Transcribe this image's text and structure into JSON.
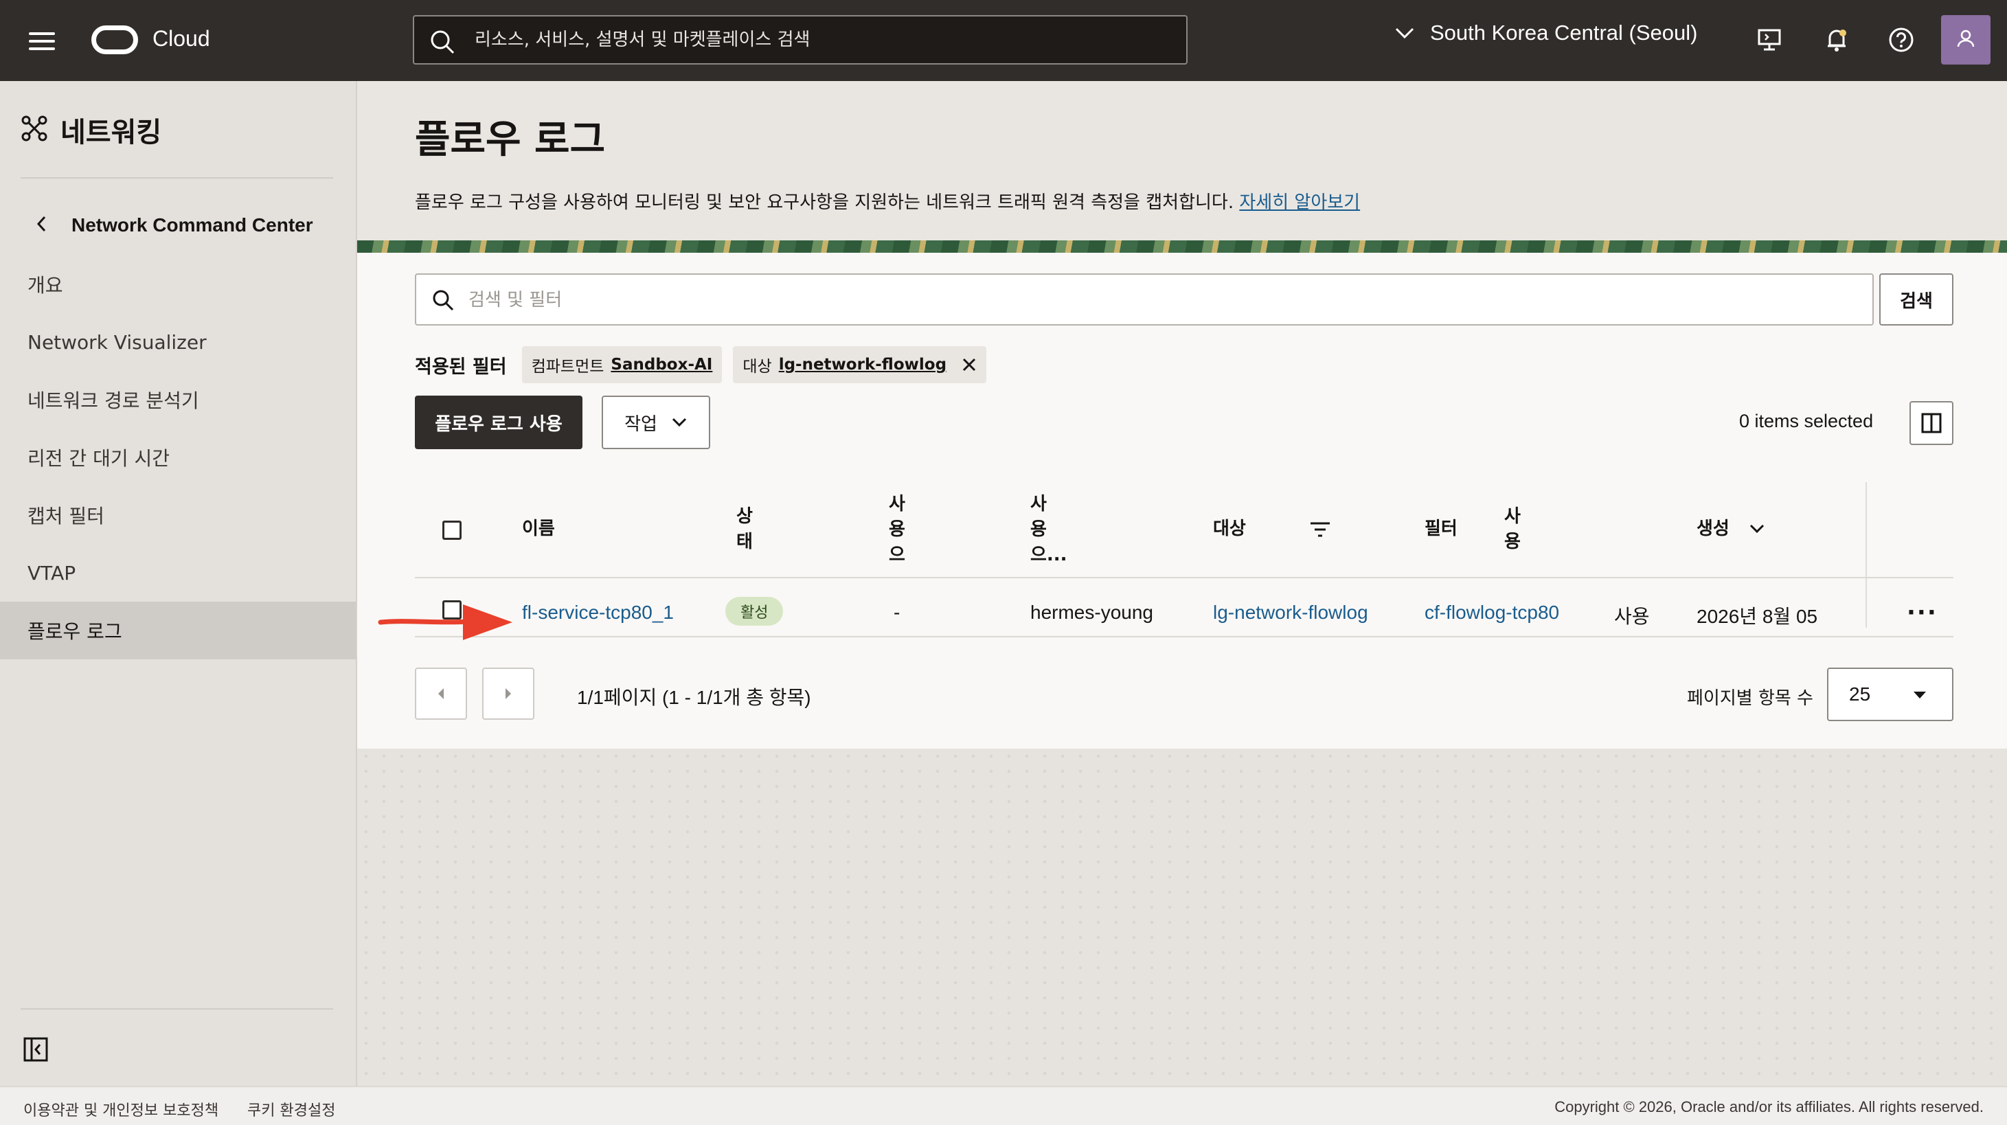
{
  "header": {
    "brand": "Cloud",
    "search_placeholder": "리소스, 서비스, 설명서 및 마켓플레이스 검색",
    "region": "South Korea Central (Seoul)",
    "icons": [
      "hamburger-menu-icon",
      "oracle-logo-icon",
      "search-icon",
      "chevron-down-icon",
      "developer-tools-icon",
      "notifications-bell-icon",
      "help-icon",
      "user-icon"
    ]
  },
  "sidebar": {
    "title": "네트워킹",
    "back_label": "Network Command Center",
    "items": [
      {
        "label": "개요",
        "active": false
      },
      {
        "label": "Network Visualizer",
        "active": false
      },
      {
        "label": "네트워크 경로 분석기",
        "active": false
      },
      {
        "label": "리전 간 대기 시간",
        "active": false
      },
      {
        "label": "캡처 필터",
        "active": false
      },
      {
        "label": "VTAP",
        "active": false
      },
      {
        "label": "플로우 로그",
        "active": true
      }
    ]
  },
  "page": {
    "title": "플로우 로그",
    "description": "플로우 로그 구성을 사용하여 모니터링 및 보안 요구사항을 지원하는 네트워크 트래픽 원격 측정을 캡처합니다.",
    "learn_more": "자세히 알아보기"
  },
  "filters": {
    "search_placeholder": "검색 및 필터",
    "search_button": "검색",
    "applied_label": "적용된 필터",
    "chips": [
      {
        "key": "컴파트먼트",
        "value": "Sandbox-AI",
        "removable": false
      },
      {
        "key": "대상",
        "value": "lg-network-flowlog",
        "removable": true
      }
    ]
  },
  "toolbar": {
    "enable_button": "플로우 로그 사용",
    "actions_button": "작업",
    "selected_text": "0 items selected"
  },
  "table": {
    "headers": {
      "name": "이름",
      "status": "상\n태",
      "col3": "사\n용\n으",
      "col4": "사\n용\n으...",
      "target": "대상",
      "filter": "필터",
      "enabled": "사\n용",
      "created": "생성"
    },
    "rows": [
      {
        "name": "fl-service-tcp80_1",
        "status": "활성",
        "col3": "-",
        "col4": "hermes-young",
        "target": "lg-network-flowlog",
        "filter": "cf-flowlog-tcp80",
        "enabled": "사용",
        "created": "2026년 8월 05"
      }
    ]
  },
  "pagination": {
    "text": "1/1페이지 (1 - 1/1개 총 항목)",
    "per_page_label": "페이지별 항목 수",
    "per_page_value": "25"
  },
  "footer": {
    "terms": "이용약관 및 개인정보 보호정책",
    "cookies": "쿠키 환경설정",
    "copyright": "Copyright © 2026, Oracle and/or its affiliates. All rights reserved."
  },
  "colors": {
    "topbar": "#312d2a",
    "link": "#1a5c8d",
    "badge_bg": "#d7e6c4",
    "annotation_arrow": "#e8402c"
  }
}
